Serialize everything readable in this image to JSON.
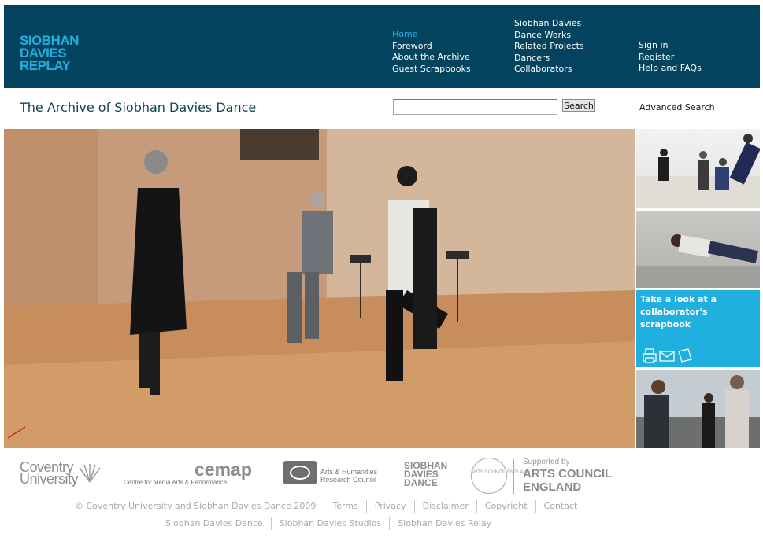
{
  "header": {
    "logo": [
      "SIOBHAN",
      "DAVIES",
      "REPLAY"
    ],
    "nav_primary": [
      "Home",
      "Foreword",
      "About the Archive",
      "Guest Scrapbooks"
    ],
    "nav_secondary": [
      "Siobhan Davies",
      "Dance Works",
      "Related Projects",
      "Dancers",
      "Collaborators"
    ],
    "nav_account": [
      "Sign in",
      "Register",
      "Help and FAQs"
    ]
  },
  "title_bar": {
    "title": "The Archive of Siobhan Davies Dance",
    "search": {
      "value": "",
      "placeholder": ""
    },
    "search_label": "Search",
    "advanced_search": "Advanced Search"
  },
  "sidebar": {
    "scrapbook_promo": "Take a look at a collaborator's scrapbook"
  },
  "partners": {
    "coventry": [
      "Coventry",
      "University"
    ],
    "cemap": {
      "name": "cemap",
      "tagline": "Centre for Media Arts & Performance"
    },
    "ahrc": [
      "Arts & Humanities",
      "Research Council"
    ],
    "siobhan_davies_dance": [
      "SIOBHAN",
      "DAVIES",
      "DANCE"
    ],
    "arts_council_circle": "ARTS COUNCIL ENGLAND",
    "supported_by": "Supported by",
    "arts_council": [
      "ARTS COUNCIL",
      "ENGLAND"
    ]
  },
  "footer": {
    "row1": [
      "© Coventry University and Siobhan Davies Dance 2009",
      "Terms",
      "Privacy",
      "Disclaimer",
      "Copyright",
      "Contact"
    ],
    "row2": [
      "Siobhan Davies Dance",
      "Siobhan Davies Studios",
      "Siobhan Davies Relay"
    ]
  },
  "colors": {
    "header_bg": "#03435e",
    "accent": "#1fb0e0",
    "title_text": "#0f3f55",
    "footer_text": "#a9a9a9"
  }
}
